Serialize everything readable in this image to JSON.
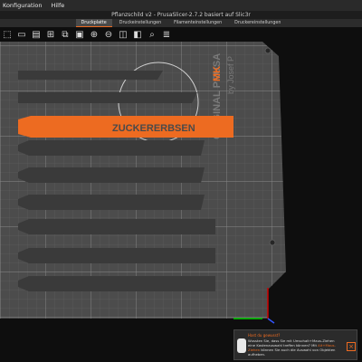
{
  "menu": {
    "items": [
      "Konfiguration",
      "Hilfe"
    ]
  },
  "window": {
    "title": "Pflanzschild v2 - PrusaSlicer-2.7.2 basiert auf Slic3r"
  },
  "tabs": [
    {
      "label": "Druckplatte",
      "active": true
    },
    {
      "label": "Druckeinstellungen",
      "active": false
    },
    {
      "label": "Filamenteinstellungen",
      "active": false
    },
    {
      "label": "Druckereinstellungen",
      "active": false
    }
  ],
  "toolbar": {
    "icons": [
      "add-icon",
      "delete-icon",
      "delete-all-icon",
      "arrange-icon",
      "copy-icon",
      "paste-icon",
      "add-instance-icon",
      "remove-instance-icon",
      "split-objects-icon",
      "split-parts-icon",
      "search-icon",
      "layer-editing-icon"
    ]
  },
  "plate": {
    "brand_main": "ORIGINAL PRUSA",
    "brand_suffix": "MK",
    "brand_by": "by Josef P",
    "selected_text": "ZUCKERERBSEN"
  },
  "colors": {
    "accent": "#ed6b21",
    "object": "#3a3a3a",
    "plate": "#4c4c4c"
  },
  "toast": {
    "title": "Hast du gewusst?",
    "text_1": "Wussten Sie, dass Sie mit Umschalt+Maus-Ziehen eine Kastenauswahl treffen können? Mit ",
    "text_link": "Alt+Maus-Ziehen",
    "text_2": " können Sie auch die Auswahl von Objekten aufheben.",
    "close_label": "×"
  }
}
